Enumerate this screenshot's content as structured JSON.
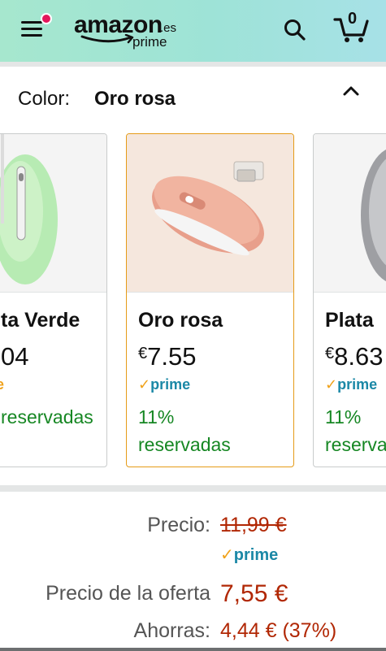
{
  "header": {
    "logo_word": "amazon",
    "logo_domain": ".es",
    "logo_sub": "prime",
    "cart_count": "0",
    "colors": {
      "background": "#a6e7ce",
      "notification": "#e3175b"
    }
  },
  "variation": {
    "label": "Color:",
    "selected": "Oro rosa"
  },
  "swatches": [
    {
      "name": "Plata Verde",
      "name_visible": "ta Verde",
      "currency": "",
      "price": "04",
      "prime": "prime",
      "availability": [
        "reservadas"
      ]
    },
    {
      "name": "Oro rosa",
      "currency": "€",
      "price": "7.55",
      "prime": "prime",
      "availability": [
        "11%",
        "reservadas"
      ]
    },
    {
      "name": "Plata",
      "currency": "€",
      "price": "8.63",
      "prime": "prime",
      "availability": [
        "11%",
        "reserva"
      ]
    }
  ],
  "pricing": {
    "list_label": "Precio:",
    "list_price": "11,99 €",
    "prime_badge": "prime",
    "deal_label": "Precio de la oferta",
    "deal_price": "7,55 €",
    "savings_label": "Ahorras:",
    "savings_value": "4,44 € (37%)",
    "price_color": "#b12704",
    "prime_color": "#1b88a6",
    "available_color": "#168723",
    "selected_border_color": "#e59b18"
  }
}
